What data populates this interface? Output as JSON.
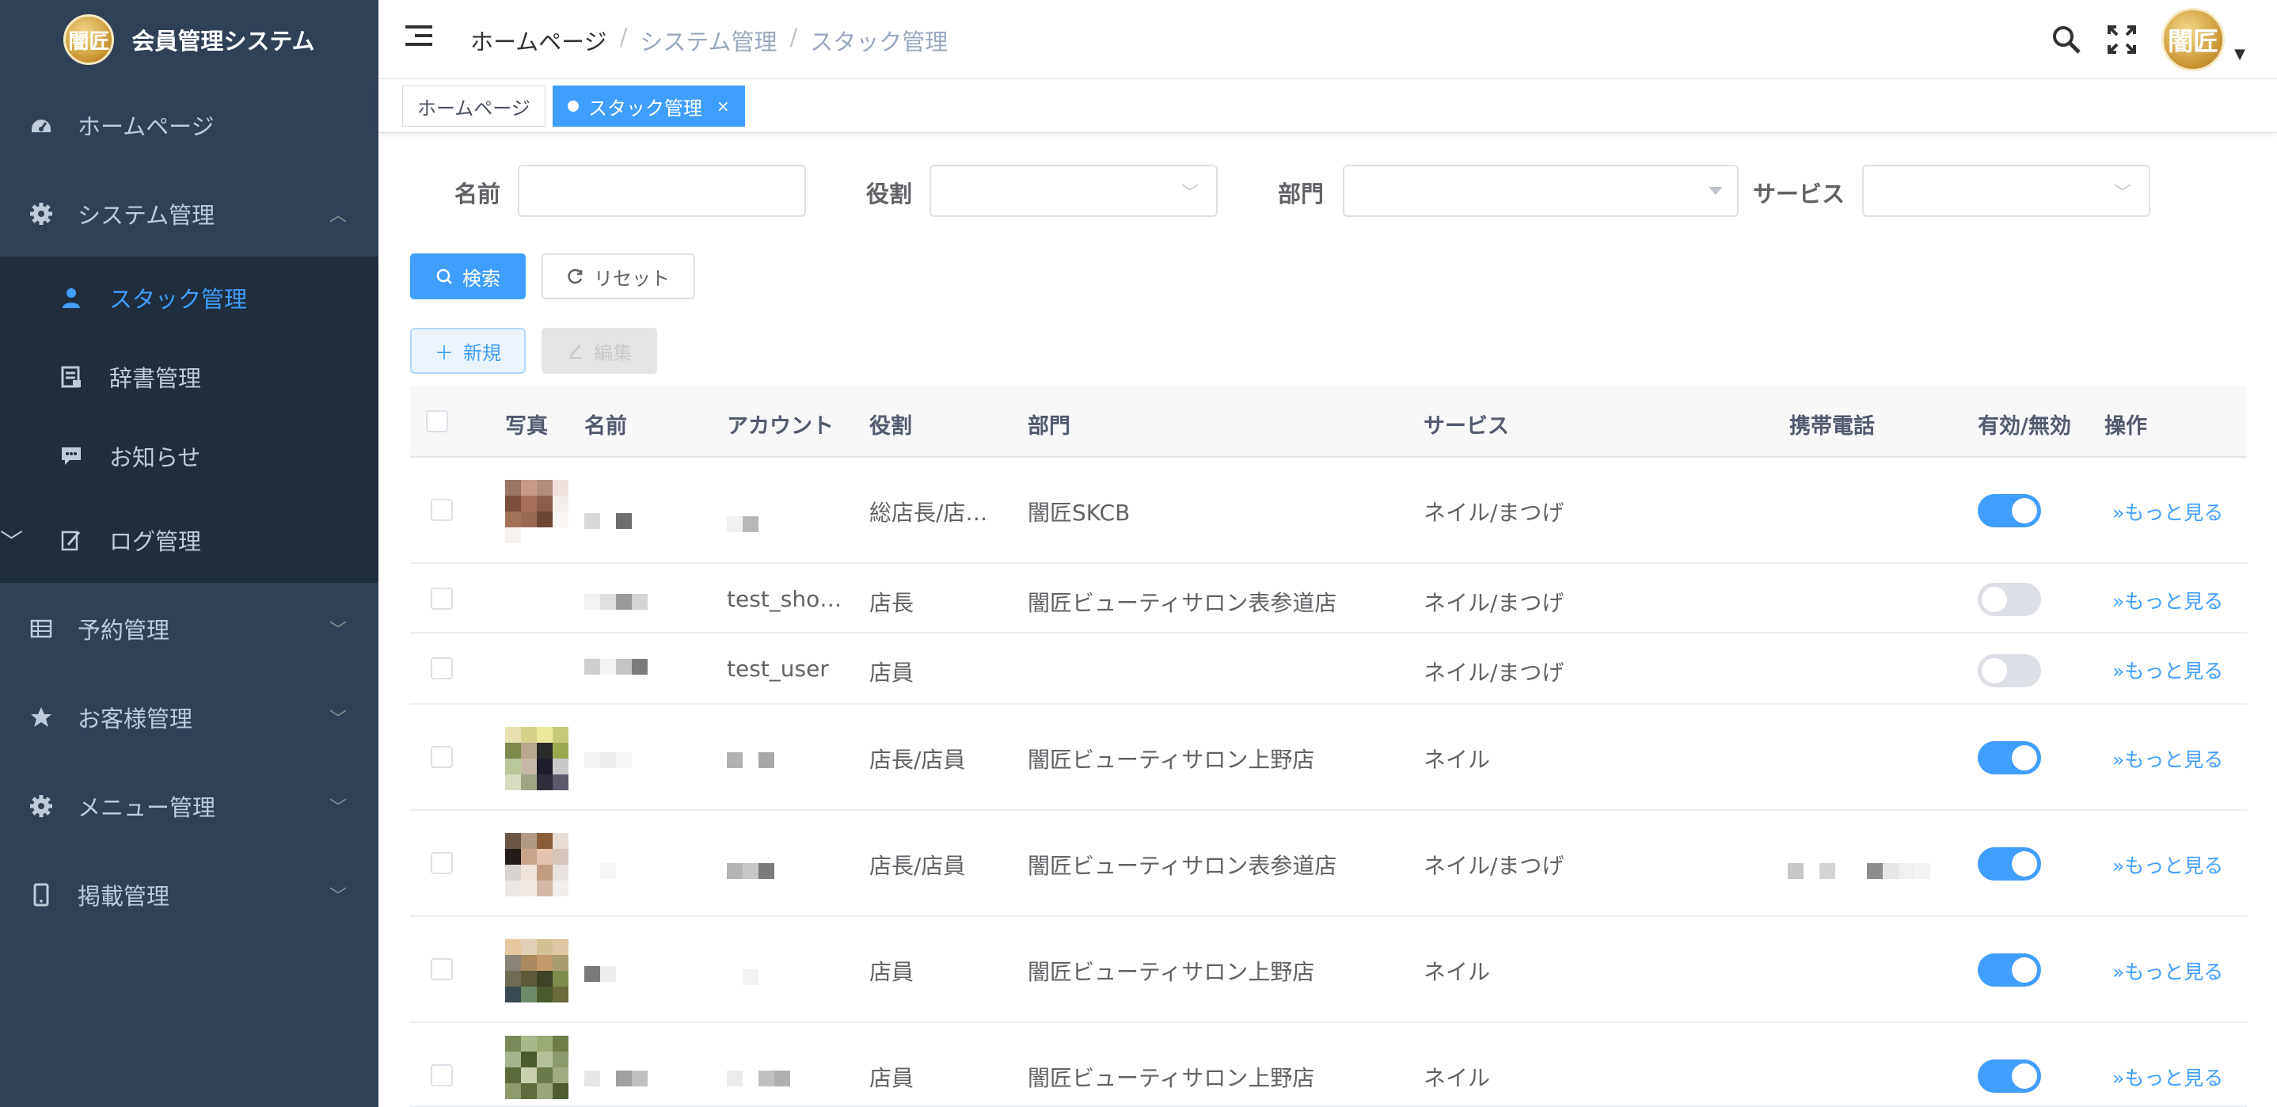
{
  "app": {
    "title": "会員管理システム",
    "logo_text": "闇匠"
  },
  "sidebar": {
    "items": [
      {
        "label": "ホームページ",
        "icon": "dashboard-icon"
      },
      {
        "label": "システム管理",
        "icon": "gear-icon"
      },
      {
        "label": "予約管理",
        "icon": "table-icon"
      },
      {
        "label": "お客様管理",
        "icon": "star-icon"
      },
      {
        "label": "メニュー管理",
        "icon": "gear-icon"
      },
      {
        "label": "掲載管理",
        "icon": "phone-icon"
      }
    ],
    "submenu": [
      {
        "label": "スタック管理",
        "icon": "user-icon"
      },
      {
        "label": "辞書管理",
        "icon": "dictionary-icon"
      },
      {
        "label": "お知らせ",
        "icon": "message-icon"
      },
      {
        "label": "ログ管理",
        "icon": "edit-icon"
      }
    ]
  },
  "header": {
    "breadcrumb": [
      "ホームページ",
      "システム管理",
      "スタック管理"
    ],
    "avatar_text": "闇匠"
  },
  "tags": [
    {
      "label": "ホームページ"
    },
    {
      "label": "スタック管理",
      "active": true
    }
  ],
  "filter": {
    "name_label": "名前",
    "role_label": "役割",
    "dept_label": "部門",
    "service_label": "サービス",
    "search_button": "検索",
    "reset_button": "リセット"
  },
  "toolbar": {
    "new_button": "新規",
    "edit_button": "編集"
  },
  "table": {
    "headers": [
      "写真",
      "名前",
      "アカウント",
      "役割",
      "部門",
      "サービス",
      "携帯電話",
      "有効/無効",
      "操作"
    ],
    "more_label": "»もっと見る",
    "rows": [
      {
        "account": "",
        "role": "総店長/店…",
        "dept": "闇匠SKCB",
        "service": "ネイル/まつげ",
        "phone": "",
        "enabled": true
      },
      {
        "account": "test_sho…",
        "role": "店長",
        "dept": "闇匠ビューティサロン表参道店",
        "service": "ネイル/まつげ",
        "phone": "",
        "enabled": false
      },
      {
        "account": "test_user",
        "role": "店員",
        "dept": "",
        "service": "ネイル/まつげ",
        "phone": "",
        "enabled": false
      },
      {
        "account": "",
        "role": "店長/店員",
        "dept": "闇匠ビューティサロン上野店",
        "service": "ネイル",
        "phone": "",
        "enabled": true
      },
      {
        "account": "",
        "role": "店長/店員",
        "dept": "闇匠ビューティサロン表参道店",
        "service": "ネイル/まつげ",
        "phone": "",
        "enabled": true
      },
      {
        "account": "",
        "role": "店員",
        "dept": "闇匠ビューティサロン上野店",
        "service": "ネイル",
        "phone": "",
        "enabled": true
      },
      {
        "account": "",
        "role": "店員",
        "dept": "闇匠ビューティサロン上野店",
        "service": "ネイル",
        "phone": "",
        "enabled": true
      }
    ]
  },
  "colors": {
    "sidebar": "#304156",
    "submenu": "#1f2d3d",
    "accent": "#409eff"
  }
}
